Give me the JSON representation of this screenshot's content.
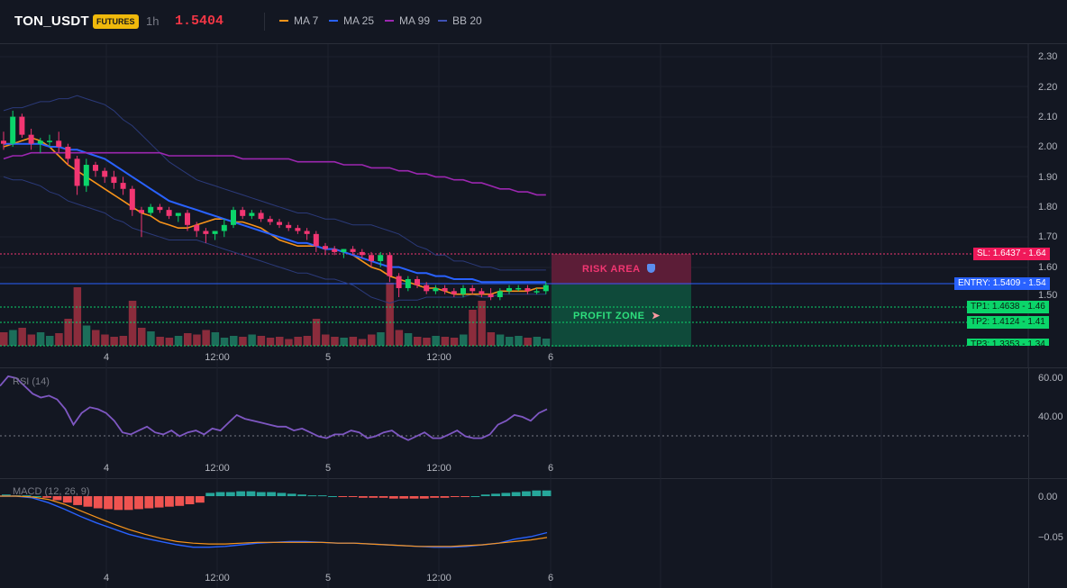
{
  "header": {
    "symbol": "TON_USDT",
    "market_badge": "FUTURES",
    "timeframe": "1h",
    "last_price": "1.5404",
    "legend": [
      {
        "label": "MA 7",
        "color": "#f7931a"
      },
      {
        "label": "MA 25",
        "color": "#2962ff"
      },
      {
        "label": "MA 99",
        "color": "#9c27b0"
      },
      {
        "label": "BB 20",
        "color": "#3f51b5"
      }
    ]
  },
  "main": {
    "y_ticks": [
      "2.30",
      "2.20",
      "2.10",
      "2.00",
      "1.90",
      "1.80",
      "1.70",
      "1.60",
      "1.50"
    ],
    "x_ticks": [
      "4",
      "12:00",
      "5",
      "12:00",
      "6"
    ],
    "levels": {
      "sl": "SL: 1.6437 - 1.64",
      "entry": "ENTRY: 1.5409 - 1.54",
      "tp1": "TP1: 1.4638 - 1.46",
      "tp2": "TP2: 1.4124 - 1.41",
      "tp3": "TP3: 1.3353 - 1.34"
    },
    "risk_label": "RISK AREA",
    "profit_label": "PROFIT ZONE"
  },
  "rsi": {
    "title": "RSI (14)",
    "y_ticks": [
      "60.00",
      "40.00"
    ],
    "x_ticks": [
      "4",
      "12:00",
      "5",
      "12:00",
      "6"
    ],
    "values": [
      56,
      61,
      60,
      56,
      52,
      50,
      51,
      49,
      44,
      36,
      42,
      45,
      44,
      42,
      38,
      32,
      31,
      33,
      35,
      32,
      31,
      33,
      30,
      32,
      33,
      31,
      34,
      33,
      37,
      41,
      39,
      38,
      37,
      36,
      35,
      35,
      33,
      34,
      32,
      30,
      29,
      31,
      31,
      33,
      32,
      29,
      30,
      32,
      33,
      30,
      28,
      30,
      32,
      29,
      29,
      31,
      33,
      30,
      29,
      29,
      31,
      36,
      38,
      41,
      40,
      38,
      42,
      44
    ]
  },
  "macd": {
    "title": "MACD (12, 26, 9)",
    "y_ticks": [
      "0.00",
      "−0.05"
    ],
    "x_ticks": [
      "4",
      "12:00",
      "5",
      "12:00",
      "6"
    ]
  },
  "chart_data": [
    {
      "type": "candlestick",
      "ylim": [
        1.46,
        2.32
      ],
      "x_ticks": [
        "4",
        "12:00",
        "5",
        "12:00",
        "6"
      ],
      "series": [
        {
          "name": "MA 7",
          "values": [
            2.0,
            2.01,
            2.02,
            2.03,
            2.02,
            2.0,
            1.97,
            1.94,
            1.92,
            1.9,
            1.88,
            1.86,
            1.84,
            1.82,
            1.8,
            1.78,
            1.77,
            1.75,
            1.74,
            1.73,
            1.73,
            1.74,
            1.75,
            1.76,
            1.76,
            1.75,
            1.75,
            1.74,
            1.73,
            1.71,
            1.69,
            1.68,
            1.67,
            1.67,
            1.67,
            1.66,
            1.66,
            1.65,
            1.64,
            1.62,
            1.6,
            1.59,
            1.57,
            1.56,
            1.55,
            1.54,
            1.53,
            1.53,
            1.52,
            1.51,
            1.51,
            1.51,
            1.51,
            1.51,
            1.52,
            1.52,
            1.52,
            1.52,
            1.53,
            1.53
          ]
        },
        {
          "name": "MA 25",
          "values": [
            2.01,
            2.01,
            2.01,
            2.01,
            2.01,
            2.0,
            2.0,
            1.99,
            1.99,
            1.98,
            1.97,
            1.96,
            1.94,
            1.92,
            1.9,
            1.88,
            1.86,
            1.84,
            1.82,
            1.81,
            1.8,
            1.79,
            1.78,
            1.77,
            1.76,
            1.75,
            1.74,
            1.73,
            1.72,
            1.71,
            1.7,
            1.69,
            1.68,
            1.68,
            1.67,
            1.66,
            1.66,
            1.65,
            1.64,
            1.63,
            1.62,
            1.61,
            1.6,
            1.6,
            1.59,
            1.58,
            1.58,
            1.57,
            1.57,
            1.56,
            1.56,
            1.56,
            1.55,
            1.55,
            1.55,
            1.55,
            1.55,
            1.55,
            1.55,
            1.55
          ]
        },
        {
          "name": "MA 99",
          "values": [
            1.96,
            1.97,
            1.97,
            1.98,
            1.98,
            1.98,
            1.98,
            1.98,
            1.98,
            1.98,
            1.98,
            1.98,
            1.98,
            1.98,
            1.98,
            1.98,
            1.98,
            1.98,
            1.97,
            1.97,
            1.97,
            1.97,
            1.97,
            1.97,
            1.97,
            1.97,
            1.96,
            1.96,
            1.96,
            1.96,
            1.96,
            1.96,
            1.95,
            1.95,
            1.95,
            1.95,
            1.95,
            1.94,
            1.94,
            1.94,
            1.93,
            1.93,
            1.93,
            1.92,
            1.92,
            1.91,
            1.91,
            1.9,
            1.9,
            1.89,
            1.89,
            1.88,
            1.88,
            1.87,
            1.86,
            1.86,
            1.85,
            1.85,
            1.84,
            1.84
          ]
        }
      ],
      "candles": [
        [
          2.02,
          2.05,
          1.99,
          2.01
        ],
        [
          2.01,
          2.12,
          2.0,
          2.1
        ],
        [
          2.1,
          2.11,
          2.03,
          2.04
        ],
        [
          2.04,
          2.06,
          1.99,
          2.01
        ],
        [
          2.01,
          2.03,
          1.98,
          2.02
        ],
        [
          2.02,
          2.04,
          2.0,
          2.02
        ],
        [
          2.02,
          2.05,
          1.98,
          2.0
        ],
        [
          2.0,
          2.01,
          1.94,
          1.96
        ],
        [
          1.96,
          1.97,
          1.84,
          1.87
        ],
        [
          1.87,
          1.96,
          1.85,
          1.94
        ],
        [
          1.94,
          1.95,
          1.9,
          1.92
        ],
        [
          1.92,
          1.93,
          1.88,
          1.9
        ],
        [
          1.9,
          1.92,
          1.86,
          1.88
        ],
        [
          1.88,
          1.9,
          1.84,
          1.86
        ],
        [
          1.86,
          1.87,
          1.77,
          1.79
        ],
        [
          1.79,
          1.8,
          1.7,
          1.78
        ],
        [
          1.78,
          1.81,
          1.77,
          1.8
        ],
        [
          1.8,
          1.81,
          1.78,
          1.79
        ],
        [
          1.79,
          1.8,
          1.76,
          1.77
        ],
        [
          1.77,
          1.78,
          1.75,
          1.78
        ],
        [
          1.78,
          1.79,
          1.72,
          1.74
        ],
        [
          1.74,
          1.75,
          1.7,
          1.72
        ],
        [
          1.72,
          1.73,
          1.68,
          1.71
        ],
        [
          1.71,
          1.72,
          1.69,
          1.72
        ],
        [
          1.72,
          1.76,
          1.7,
          1.74
        ],
        [
          1.74,
          1.8,
          1.73,
          1.79
        ],
        [
          1.79,
          1.8,
          1.76,
          1.77
        ],
        [
          1.77,
          1.79,
          1.76,
          1.78
        ],
        [
          1.78,
          1.79,
          1.75,
          1.76
        ],
        [
          1.76,
          1.77,
          1.74,
          1.75
        ],
        [
          1.75,
          1.76,
          1.73,
          1.74
        ],
        [
          1.74,
          1.75,
          1.72,
          1.73
        ],
        [
          1.73,
          1.74,
          1.71,
          1.72
        ],
        [
          1.72,
          1.73,
          1.69,
          1.71
        ],
        [
          1.71,
          1.72,
          1.65,
          1.67
        ],
        [
          1.67,
          1.68,
          1.64,
          1.66
        ],
        [
          1.66,
          1.67,
          1.64,
          1.65
        ],
        [
          1.65,
          1.66,
          1.63,
          1.66
        ],
        [
          1.66,
          1.67,
          1.64,
          1.65
        ],
        [
          1.65,
          1.66,
          1.63,
          1.64
        ],
        [
          1.64,
          1.65,
          1.6,
          1.62
        ],
        [
          1.62,
          1.65,
          1.6,
          1.64
        ],
        [
          1.64,
          1.65,
          1.55,
          1.57
        ],
        [
          1.57,
          1.58,
          1.5,
          1.53
        ],
        [
          1.53,
          1.57,
          1.52,
          1.56
        ],
        [
          1.56,
          1.57,
          1.53,
          1.54
        ],
        [
          1.54,
          1.55,
          1.51,
          1.52
        ],
        [
          1.52,
          1.54,
          1.51,
          1.53
        ],
        [
          1.53,
          1.54,
          1.51,
          1.52
        ],
        [
          1.52,
          1.53,
          1.5,
          1.51
        ],
        [
          1.51,
          1.54,
          1.5,
          1.53
        ],
        [
          1.53,
          1.54,
          1.51,
          1.52
        ],
        [
          1.52,
          1.53,
          1.5,
          1.51
        ],
        [
          1.51,
          1.53,
          1.49,
          1.5
        ],
        [
          1.5,
          1.53,
          1.49,
          1.52
        ],
        [
          1.52,
          1.54,
          1.51,
          1.53
        ],
        [
          1.53,
          1.54,
          1.52,
          1.53
        ],
        [
          1.53,
          1.54,
          1.51,
          1.52
        ],
        [
          1.52,
          1.53,
          1.51,
          1.52
        ],
        [
          1.52,
          1.55,
          1.51,
          1.54
        ]
      ],
      "volume": [
        30,
        35,
        40,
        25,
        30,
        22,
        28,
        60,
        130,
        45,
        35,
        25,
        20,
        22,
        100,
        40,
        32,
        20,
        18,
        22,
        28,
        25,
        35,
        30,
        18,
        22,
        20,
        25,
        22,
        18,
        20,
        15,
        20,
        22,
        60,
        25,
        20,
        18,
        20,
        15,
        25,
        30,
        140,
        35,
        28,
        20,
        18,
        22,
        20,
        18,
        25,
        80,
        100,
        30,
        25,
        20,
        22,
        18,
        20,
        16
      ]
    },
    {
      "type": "line",
      "title": "RSI (14)",
      "ylim": [
        20,
        70
      ],
      "series": [
        {
          "name": "RSI (14)",
          "values": [
            56,
            61,
            60,
            56,
            52,
            50,
            51,
            49,
            44,
            36,
            42,
            45,
            44,
            42,
            38,
            32,
            31,
            33,
            35,
            32,
            31,
            33,
            30,
            32,
            33,
            31,
            34,
            33,
            37,
            41,
            39,
            38,
            37,
            36,
            35,
            35,
            33,
            34,
            32,
            30,
            29,
            31,
            31,
            33,
            32,
            29,
            30,
            32,
            33,
            30,
            28,
            30,
            32,
            29,
            29,
            31,
            33,
            30,
            29,
            29,
            31,
            36,
            38,
            41,
            40,
            38,
            42,
            44
          ]
        }
      ]
    },
    {
      "type": "bar",
      "title": "MACD (12, 26, 9)",
      "ylim": [
        -0.08,
        0.02
      ],
      "series": [
        {
          "name": "histogram",
          "values": [
            0.002,
            0.001,
            0.001,
            0.0,
            -0.002,
            -0.005,
            -0.008,
            -0.011,
            -0.013,
            -0.015,
            -0.016,
            -0.017,
            -0.017,
            -0.016,
            -0.015,
            -0.014,
            -0.013,
            -0.012,
            -0.01,
            -0.008,
            0.004,
            0.005,
            0.005,
            0.006,
            0.006,
            0.005,
            0.005,
            0.004,
            0.003,
            0.002,
            0.001,
            0.001,
            0.0,
            -0.001,
            -0.001,
            -0.002,
            -0.002,
            -0.002,
            -0.003,
            -0.003,
            -0.003,
            -0.003,
            -0.002,
            -0.002,
            -0.001,
            -0.001,
            0.0,
            0.002,
            0.003,
            0.004,
            0.005,
            0.006,
            0.007,
            0.007
          ]
        },
        {
          "name": "MACD",
          "values": [
            0.0,
            0.0,
            -0.002,
            -0.008,
            -0.016,
            -0.025,
            -0.033,
            -0.04,
            -0.047,
            -0.052,
            -0.056,
            -0.06,
            -0.063,
            -0.063,
            -0.062,
            -0.06,
            -0.058,
            -0.057,
            -0.056,
            -0.056,
            -0.057,
            -0.058,
            -0.058,
            -0.059,
            -0.06,
            -0.061,
            -0.062,
            -0.063,
            -0.063,
            -0.062,
            -0.06,
            -0.058,
            -0.053,
            -0.05,
            -0.045
          ]
        },
        {
          "name": "Signal",
          "values": [
            0.0,
            0.0,
            -0.001,
            -0.004,
            -0.01,
            -0.018,
            -0.026,
            -0.034,
            -0.041,
            -0.047,
            -0.052,
            -0.056,
            -0.058,
            -0.059,
            -0.059,
            -0.058,
            -0.057,
            -0.057,
            -0.057,
            -0.057,
            -0.057,
            -0.058,
            -0.058,
            -0.059,
            -0.06,
            -0.061,
            -0.062,
            -0.062,
            -0.062,
            -0.061,
            -0.06,
            -0.058,
            -0.056,
            -0.054,
            -0.051
          ]
        }
      ]
    }
  ]
}
